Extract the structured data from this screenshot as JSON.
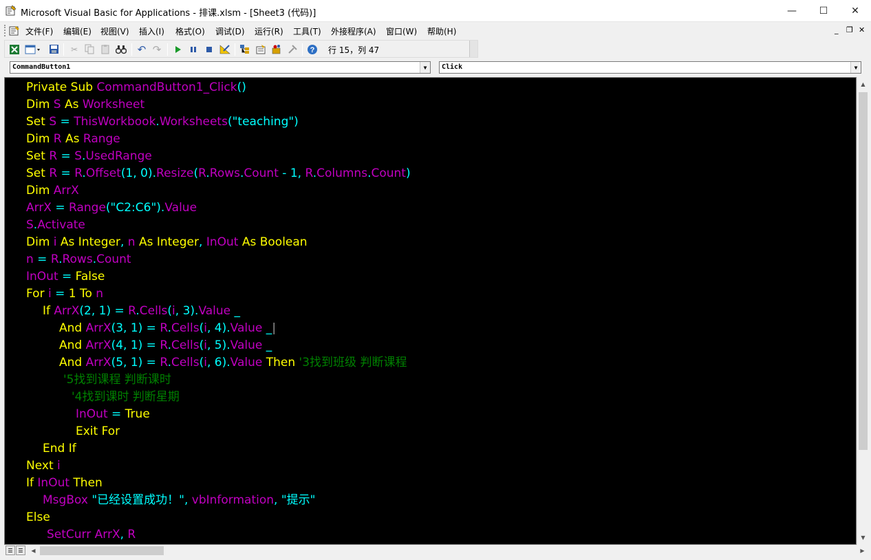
{
  "window": {
    "title": "Microsoft Visual Basic for Applications - 排课.xlsm - [Sheet3 (代码)]",
    "minimize_glyph": "—",
    "maximize_glyph": "☐",
    "close_glyph": "✕"
  },
  "menubar": {
    "items": [
      "文件(F)",
      "编辑(E)",
      "视图(V)",
      "插入(I)",
      "格式(O)",
      "调试(D)",
      "运行(R)",
      "工具(T)",
      "外接程序(A)",
      "窗口(W)",
      "帮助(H)"
    ],
    "mdi_min": "_",
    "mdi_restore": "❐",
    "mdi_close": "✕"
  },
  "toolbar": {
    "icons": [
      "excel-icon",
      "insert-module-icon",
      "save-icon",
      "cut-icon",
      "copy-icon",
      "paste-icon",
      "find-icon",
      "undo-icon",
      "redo-icon",
      "run-icon",
      "break-icon",
      "reset-icon",
      "design-mode-icon",
      "project-explorer-icon",
      "properties-icon",
      "object-browser-icon",
      "toolbox-icon",
      "help-icon"
    ],
    "position": "行 15，列 47"
  },
  "combos": {
    "object": "CommandButton1",
    "procedure": "Click"
  },
  "colors": {
    "keyword": "#ffff00",
    "identifier": "#c000c0",
    "plain": "#00ffff",
    "comment": "#008000",
    "background": "#000000"
  },
  "code_lines": [
    {
      "indent": 0,
      "tokens": [
        [
          "k",
          "Private Sub "
        ],
        [
          "i",
          "CommandButton1_Click"
        ],
        [
          "p",
          "()"
        ]
      ]
    },
    {
      "indent": 0,
      "tokens": [
        [
          "k",
          "Dim "
        ],
        [
          "i",
          "S"
        ],
        [
          "k",
          " As "
        ],
        [
          "i",
          "Worksheet"
        ]
      ]
    },
    {
      "indent": 0,
      "tokens": [
        [
          "k",
          "Set "
        ],
        [
          "i",
          "S"
        ],
        [
          "p",
          " = "
        ],
        [
          "i",
          "ThisWorkbook"
        ],
        [
          "p",
          "."
        ],
        [
          "i",
          "Worksheets"
        ],
        [
          "p",
          "(\"teaching\")"
        ]
      ]
    },
    {
      "indent": 0,
      "tokens": [
        [
          "k",
          "Dim "
        ],
        [
          "i",
          "R"
        ],
        [
          "k",
          " As "
        ],
        [
          "i",
          "Range"
        ]
      ]
    },
    {
      "indent": 0,
      "tokens": [
        [
          "k",
          "Set "
        ],
        [
          "i",
          "R"
        ],
        [
          "p",
          " = "
        ],
        [
          "i",
          "S"
        ],
        [
          "p",
          "."
        ],
        [
          "i",
          "UsedRange"
        ]
      ]
    },
    {
      "indent": 0,
      "tokens": [
        [
          "k",
          "Set "
        ],
        [
          "i",
          "R"
        ],
        [
          "p",
          " = "
        ],
        [
          "i",
          "R"
        ],
        [
          "p",
          "."
        ],
        [
          "i",
          "Offset"
        ],
        [
          "p",
          "(1, 0)."
        ],
        [
          "i",
          "Resize"
        ],
        [
          "p",
          "("
        ],
        [
          "i",
          "R"
        ],
        [
          "p",
          "."
        ],
        [
          "i",
          "Rows"
        ],
        [
          "p",
          "."
        ],
        [
          "i",
          "Count"
        ],
        [
          "p",
          " - 1, "
        ],
        [
          "i",
          "R"
        ],
        [
          "p",
          "."
        ],
        [
          "i",
          "Columns"
        ],
        [
          "p",
          "."
        ],
        [
          "i",
          "Count"
        ],
        [
          "p",
          ")"
        ]
      ]
    },
    {
      "indent": 0,
      "tokens": [
        [
          "k",
          "Dim "
        ],
        [
          "i",
          "ArrX"
        ]
      ]
    },
    {
      "indent": 0,
      "tokens": [
        [
          "i",
          "ArrX"
        ],
        [
          "p",
          " = "
        ],
        [
          "i",
          "Range"
        ],
        [
          "p",
          "(\"C2:C6\")."
        ],
        [
          "i",
          "Value"
        ]
      ]
    },
    {
      "indent": 0,
      "tokens": [
        [
          "i",
          "S"
        ],
        [
          "p",
          "."
        ],
        [
          "i",
          "Activate"
        ]
      ]
    },
    {
      "indent": 0,
      "tokens": [
        [
          "k",
          "Dim "
        ],
        [
          "i",
          "i"
        ],
        [
          "k",
          " As Integer"
        ],
        [
          "p",
          ", "
        ],
        [
          "i",
          "n"
        ],
        [
          "k",
          " As Integer"
        ],
        [
          "p",
          ", "
        ],
        [
          "i",
          "InOut"
        ],
        [
          "k",
          " As Boolean"
        ]
      ]
    },
    {
      "indent": 0,
      "tokens": [
        [
          "i",
          "n"
        ],
        [
          "p",
          " = "
        ],
        [
          "i",
          "R"
        ],
        [
          "p",
          "."
        ],
        [
          "i",
          "Rows"
        ],
        [
          "p",
          "."
        ],
        [
          "i",
          "Count"
        ]
      ]
    },
    {
      "indent": 0,
      "tokens": [
        [
          "i",
          "InOut"
        ],
        [
          "p",
          " = "
        ],
        [
          "k",
          "False"
        ]
      ]
    },
    {
      "indent": 0,
      "tokens": [
        [
          "k",
          "For "
        ],
        [
          "i",
          "i"
        ],
        [
          "p",
          " = "
        ],
        [
          "k",
          "1 To "
        ],
        [
          "i",
          "n"
        ]
      ]
    },
    {
      "indent": 24,
      "tokens": [
        [
          "k",
          "If "
        ],
        [
          "i",
          "ArrX"
        ],
        [
          "p",
          "(2, 1) = "
        ],
        [
          "i",
          "R"
        ],
        [
          "p",
          "."
        ],
        [
          "i",
          "Cells"
        ],
        [
          "p",
          "("
        ],
        [
          "i",
          "i"
        ],
        [
          "p",
          ", 3)."
        ],
        [
          "i",
          "Value"
        ],
        [
          "p",
          " _"
        ]
      ]
    },
    {
      "indent": 48,
      "tokens": [
        [
          "k",
          "And "
        ],
        [
          "i",
          "ArrX"
        ],
        [
          "p",
          "(3, 1) = "
        ],
        [
          "i",
          "R"
        ],
        [
          "p",
          "."
        ],
        [
          "i",
          "Cells"
        ],
        [
          "p",
          "("
        ],
        [
          "i",
          "i"
        ],
        [
          "p",
          ", 4)."
        ],
        [
          "i",
          "Value"
        ],
        [
          "p",
          " _"
        ],
        [
          "c",
          "|"
        ]
      ]
    },
    {
      "indent": 48,
      "tokens": [
        [
          "k",
          "And "
        ],
        [
          "i",
          "ArrX"
        ],
        [
          "p",
          "(4, 1) = "
        ],
        [
          "i",
          "R"
        ],
        [
          "p",
          "."
        ],
        [
          "i",
          "Cells"
        ],
        [
          "p",
          "("
        ],
        [
          "i",
          "i"
        ],
        [
          "p",
          ", 5)."
        ],
        [
          "i",
          "Value"
        ],
        [
          "p",
          " _"
        ]
      ]
    },
    {
      "indent": 48,
      "tokens": [
        [
          "k",
          "And "
        ],
        [
          "i",
          "ArrX"
        ],
        [
          "p",
          "(5, 1) = "
        ],
        [
          "i",
          "R"
        ],
        [
          "p",
          "."
        ],
        [
          "i",
          "Cells"
        ],
        [
          "p",
          "("
        ],
        [
          "i",
          "i"
        ],
        [
          "p",
          ", 6)."
        ],
        [
          "i",
          "Value"
        ],
        [
          "k",
          " Then "
        ],
        [
          "m",
          "'3找到班级 判断课程"
        ]
      ]
    },
    {
      "indent": 54,
      "tokens": [
        [
          "m",
          "'5找到课程 判断课时"
        ]
      ]
    },
    {
      "indent": 66,
      "tokens": [
        [
          "m",
          "'4找到课时 判断星期"
        ]
      ]
    },
    {
      "indent": 72,
      "tokens": [
        [
          "i",
          "InOut"
        ],
        [
          "p",
          " = "
        ],
        [
          "k",
          "True"
        ]
      ]
    },
    {
      "indent": 72,
      "tokens": [
        [
          "k",
          "Exit For"
        ]
      ]
    },
    {
      "indent": 24,
      "tokens": [
        [
          "k",
          "End If"
        ]
      ]
    },
    {
      "indent": 0,
      "tokens": [
        [
          "k",
          "Next "
        ],
        [
          "i",
          "i"
        ]
      ]
    },
    {
      "indent": 0,
      "tokens": [
        [
          "k",
          "If "
        ],
        [
          "i",
          "InOut"
        ],
        [
          "k",
          " Then"
        ]
      ]
    },
    {
      "indent": 24,
      "tokens": [
        [
          "i",
          "MsgBox "
        ],
        [
          "p",
          "\"已经设置成功！\", "
        ],
        [
          "i",
          "vbInformation"
        ],
        [
          "p",
          ", \"提示\""
        ]
      ]
    },
    {
      "indent": 0,
      "tokens": [
        [
          "k",
          "Else"
        ]
      ]
    },
    {
      "indent": 30,
      "tokens": [
        [
          "i",
          "SetCurr ArrX"
        ],
        [
          "p",
          ", "
        ],
        [
          "i",
          "R"
        ]
      ]
    }
  ]
}
